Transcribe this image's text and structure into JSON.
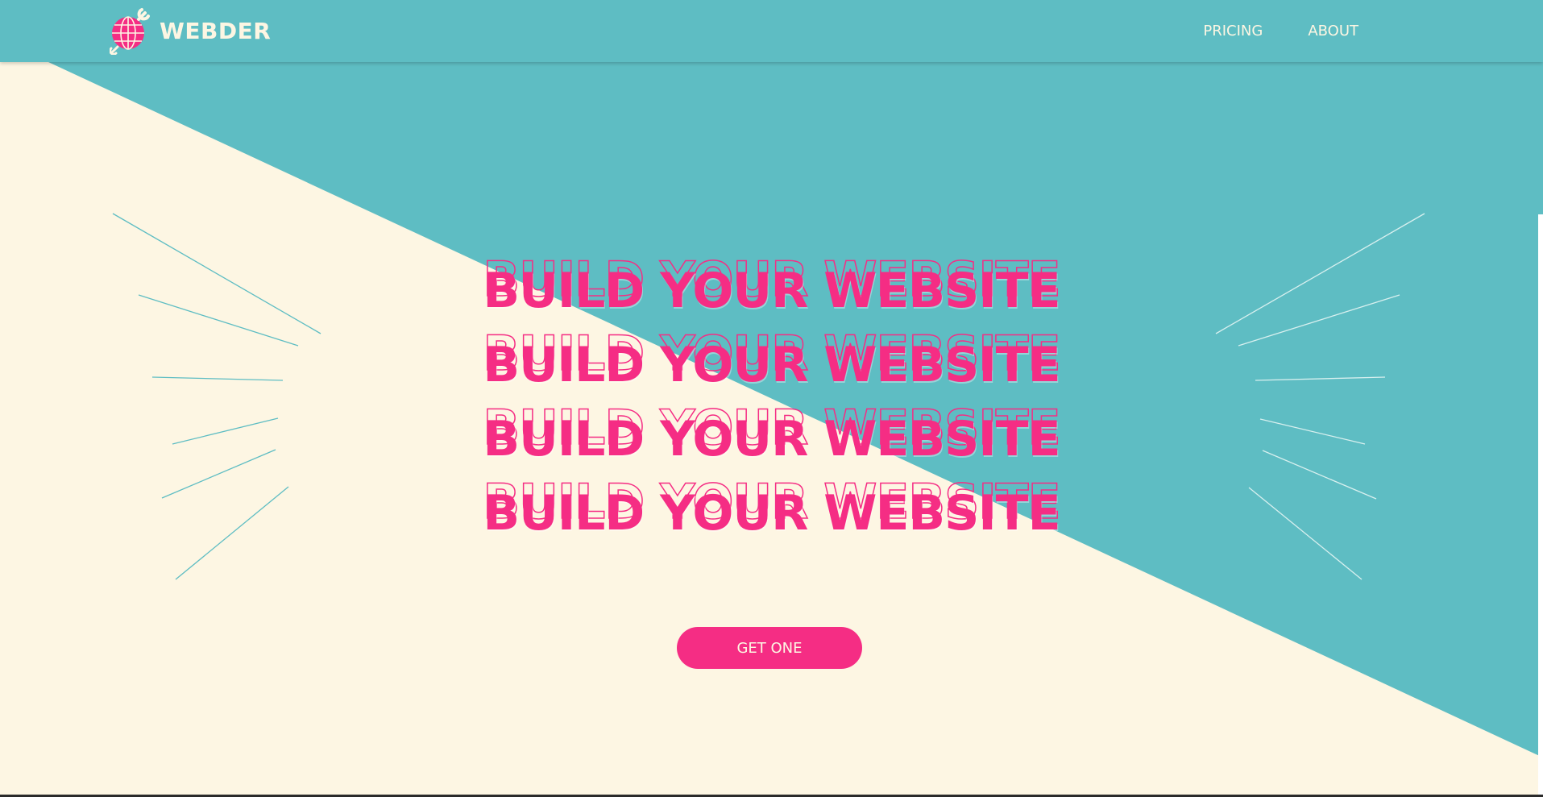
{
  "brand": {
    "name": "WEBDER",
    "icon": "globe-wrench-icon"
  },
  "nav": [
    {
      "label": "PRICING"
    },
    {
      "label": "ABOUT"
    }
  ],
  "hero": {
    "lines": [
      "BUILD YOUR WEBSITE",
      "BUILD YOUR WEBSITE",
      "BUILD YOUR WEBSITE",
      "BUILD YOUR WEBSITE"
    ],
    "cta_label": "GET ONE"
  },
  "colors": {
    "teal": "#5ebdc3",
    "cream": "#fdf6e3",
    "pink": "#f52d84"
  }
}
